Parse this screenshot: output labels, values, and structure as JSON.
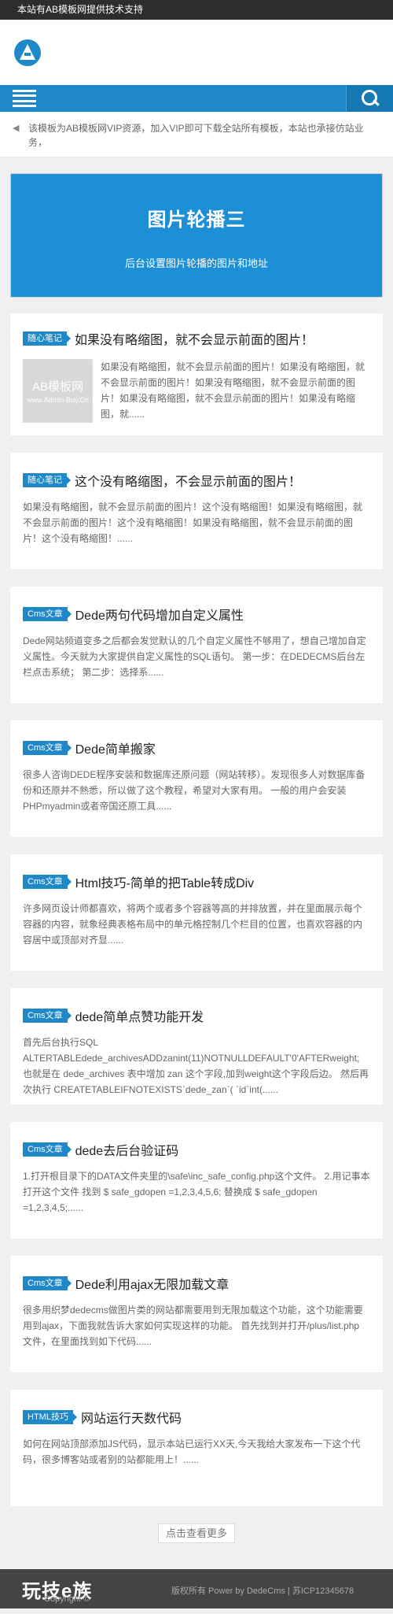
{
  "topbar": {
    "text": "本站有AB模板网提供技术支持"
  },
  "notice": {
    "text": "该模板为AB模板网VIP资源，加入VIP即可下载全站所有模板，本站也承接仿站业务，"
  },
  "banner": {
    "title": "图片轮播三",
    "subtitle": "后台设置图片轮播的图片和地址"
  },
  "posts": [
    {
      "tag": "随心笔记",
      "title": "如果没有略缩图，就不会显示前面的图片！",
      "excerpt": "如果没有略缩图，就不会显示前面的图片！如果没有略缩图，就不会显示前面的图片！如果没有略缩图，就不会显示前面的图片！如果没有略缩图，就不会显示前面的图片！如果没有略缩图，就......",
      "thumb": {
        "title": "AB模板网",
        "sub": "www.Admin-Buy.Cn"
      }
    },
    {
      "tag": "随心笔记",
      "title": "这个没有略缩图，不会显示前面的图片！",
      "excerpt": "如果没有略缩图，就不会显示前面的图片！这个没有略缩图！如果没有略缩图，就不会显示前面的图片！这个没有略缩图！如果没有略缩图，就不会显示前面的图片！这个没有略缩图！......"
    },
    {
      "tag": "Cms文章",
      "title": "Dede两句代码增加自定义属性",
      "excerpt": "Dede网站频道变多之后都会发觉默认的几个自定义属性不够用了，想自己增加自定义属性。今天就为大家提供自定义属性的SQL语句。 第一步：在DEDECMS后台左栏点击系统； 第二步：选择系......"
    },
    {
      "tag": "Cms文章",
      "title": "Dede简单搬家",
      "excerpt": "很多人咨询DEDE程序安装和数据库还原问题（网站转移）。发现很多人对数据库备份和还原并不熟悉，所以做了这个教程，希望对大家有用。 一般的用户会安装PHPmyadmin或者帝国还原工具......"
    },
    {
      "tag": "Cms文章",
      "title": "Html技巧-简单的把Table转成Div",
      "excerpt": "许多网页设计师都喜欢，将两个或者多个容器等高的并排放置，并在里面展示每个容器的内容，就象经典表格布局中的单元格控制几个栏目的位置，也喜欢容器的内容居中或顶部对齐显......"
    },
    {
      "tag": "Cms文章",
      "title": "dede简单点赞功能开发",
      "excerpt": "首先后台执行SQL ALTERTABLEdede_archivesADDzanint(11)NOTNULLDEFAULT'0'AFTERweight; 也就是在 dede_archives 表中增加 zan 这个字段,加到weight这个字段后边。 然后再次执行 CREATETABLEIFNOTEXISTS`dede_zan`( `id`int(......"
    },
    {
      "tag": "Cms文章",
      "title": "dede去后台验证码",
      "excerpt": "1.打开根目录下的DATA文件夹里的\\safe\\inc_safe_config.php这个文件。 2.用记事本打开这个文件 找到 $ safe_gdopen =1,2,3,4,5,6; 替换成 $ safe_gdopen =1,2,3,4,5;......"
    },
    {
      "tag": "Cms文章",
      "title": "Dede利用ajax无限加载文章",
      "excerpt": "很多用织梦dedecms做图片类的网站都需要用到无限加载这个功能，这个功能需要用到ajax，下面我就告诉大家如何实现这样的功能。 首先找到并打开/plus/list.php 文件，在里面找到如下代码......"
    },
    {
      "tag": "HTML技巧",
      "title": "网站运行天数代码",
      "excerpt": "如何在网站顶部添加JS代码，显示本站已运行XX天,今天我给大家发布一下这个代码，很多博客站或者别的站都能用上！......"
    }
  ],
  "more_label": "点击查看更多",
  "footer": {
    "logo": "玩技e族",
    "copyright": "Copyright ©",
    "right_text": "版权所有 Power by DedeCms | 苏ICP12345678"
  },
  "colors": {
    "accent": "#1e88c9",
    "banner": "#1c8fd6"
  }
}
